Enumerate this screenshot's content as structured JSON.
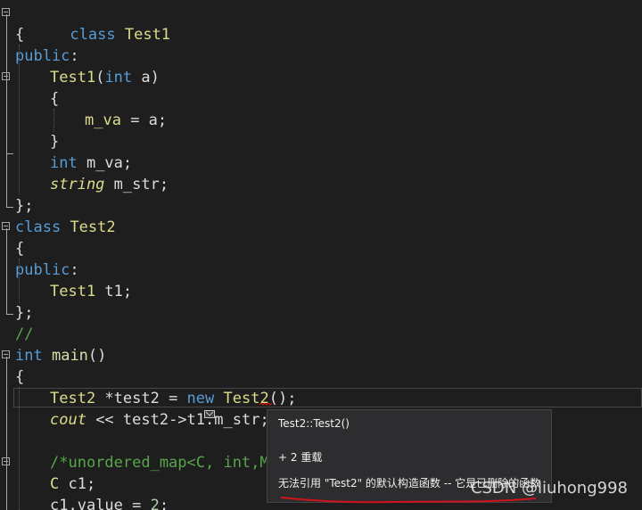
{
  "code_lines": {
    "l1": {
      "kw": "class",
      "name": "Test1"
    },
    "l2": {
      "brace": "{"
    },
    "l3": {
      "access": "public",
      "colon": ":"
    },
    "l4": {
      "name": "Test1",
      "open": "(",
      "type": "int",
      "param": " a",
      "close": ")"
    },
    "l5": {
      "brace": "{"
    },
    "l6": {
      "member": "m_va",
      "rest": " = a;"
    },
    "l7": {
      "brace": "}"
    },
    "l8": {
      "type": "int",
      "rest": " m_va;"
    },
    "l9": {
      "type": "string",
      "rest": " m_str;"
    },
    "l10": {
      "brace": "};"
    },
    "l11": {
      "kw": "class",
      "name": "Test2"
    },
    "l12": {
      "brace": "{"
    },
    "l13": {
      "access": "public",
      "colon": ":"
    },
    "l14": {
      "type": "Test1",
      "rest": " t1;"
    },
    "l15": {
      "brace": "};"
    },
    "l16": {
      "comment": "//"
    },
    "l17": {
      "type": "int",
      "func": "main",
      "parens": "()"
    },
    "l18": {
      "brace": "{"
    },
    "l19": {
      "type": "Test2",
      "ptr": " *test2 = ",
      "kw": "new",
      "space": " ",
      "ctor": "Test2",
      "parens": "()",
      "semi": ";"
    },
    "l20": {
      "obj": "cout",
      "op": " << test2->t1.",
      "member": "m_str",
      "semi": ";"
    },
    "l21": {
      "comment": "/*unordered_map<C, int,My"
    },
    "l22": {
      "type": "C",
      "rest": " c1;"
    },
    "l23": {
      "obj": "c1.",
      "member": "value",
      "eq": " = ",
      "num": "2",
      "semi": ";"
    }
  },
  "tooltip": {
    "signature": "Test2::Test2()",
    "overloads": "+ 2 重载",
    "error": "无法引用 \"Test2\" 的默认构造函数 -- 它是已删除的函数"
  },
  "watermark": "CSDN @liuhong998",
  "colors": {
    "background": "#1e1e1e",
    "keyword": "#569cd6",
    "class_name": "#dcdc8b",
    "comment": "#57a64a",
    "error_underline": "#e51400"
  }
}
